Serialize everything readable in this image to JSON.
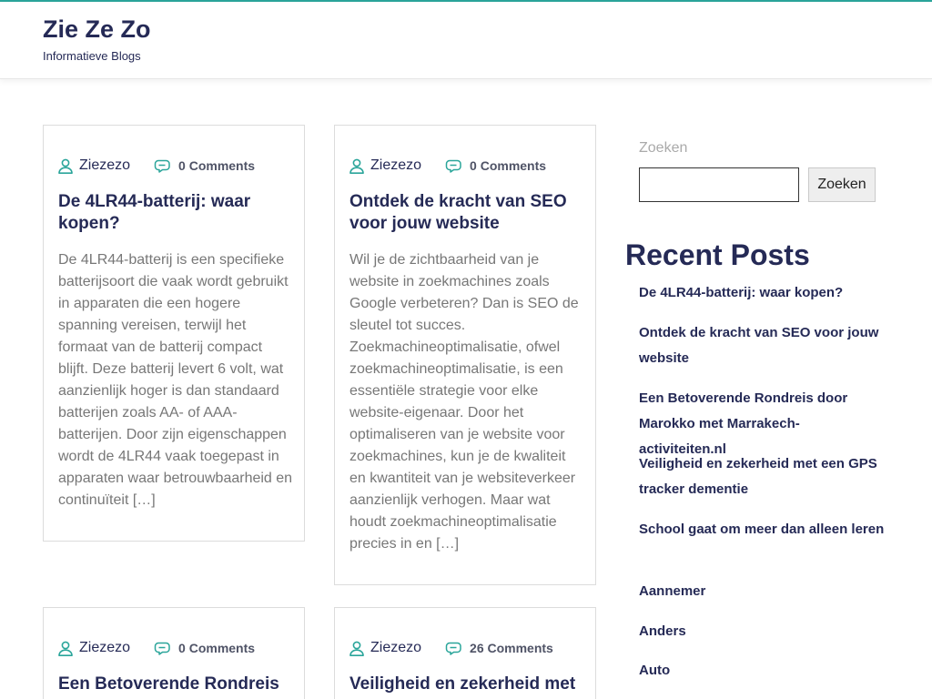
{
  "site": {
    "title": "Zie Ze Zo",
    "tagline": "Informatieve Blogs"
  },
  "colors": {
    "accent": "#2aa59a",
    "navy": "#252a56",
    "body_text": "#777777"
  },
  "posts": [
    {
      "author": "Ziezezo",
      "comments": "0 Comments",
      "title": "De 4LR44-batterij: waar kopen?",
      "excerpt": "De 4LR44-batterij is een specifieke batterijsoort die vaak wordt gebruikt in apparaten die een hogere spanning vereisen, terwijl het formaat van de batterij compact blijft. Deze batterij levert 6 volt, wat aanzienlijk hoger is dan standaard batterijen zoals AA- of AAA-batterijen. Door zijn eigenschappen wordt de 4LR44 vaak toegepast in apparaten waar betrouwbaarheid en continuïteit […]"
    },
    {
      "author": "Ziezezo",
      "comments": "0 Comments",
      "title": "Ontdek de kracht van SEO voor jouw website",
      "excerpt": "Wil je de zichtbaarheid van je website in zoekmachines zoals Google verbeteren? Dan is SEO de sleutel tot succes. Zoekmachineoptimalisatie, ofwel zoekmachineoptimalisatie, is een essentiële strategie voor elke website-eigenaar. Door het optimaliseren van je website voor zoekmachines, kun je de kwaliteit en kwantiteit van je websiteverkeer aanzienlijk verhogen. Maar wat houdt zoekmachineoptimalisatie precies in en […]"
    },
    {
      "author": "Ziezezo",
      "comments": "0 Comments",
      "title": "Een Betoverende Rondreis",
      "excerpt": ""
    },
    {
      "author": "Ziezezo",
      "comments": "26 Comments",
      "title": "Veiligheid en zekerheid met",
      "excerpt": ""
    }
  ],
  "sidebar": {
    "search_label": "Zoeken",
    "search_value": "",
    "search_button": "Zoeken",
    "recent_title": "Recent Posts",
    "recent_posts": [
      "De 4LR44-batterij: waar kopen?",
      "Ontdek de kracht van SEO voor jouw website",
      "Een Betoverende Rondreis door Marokko met Marrakech-activiteiten.nl",
      "Veiligheid en zekerheid met een GPS tracker dementie",
      "School gaat om meer dan alleen leren"
    ],
    "categories": [
      "Aannemer",
      "Anders",
      "Auto"
    ]
  },
  "icons": {
    "author": "user-icon",
    "comments": "comment-icon"
  }
}
